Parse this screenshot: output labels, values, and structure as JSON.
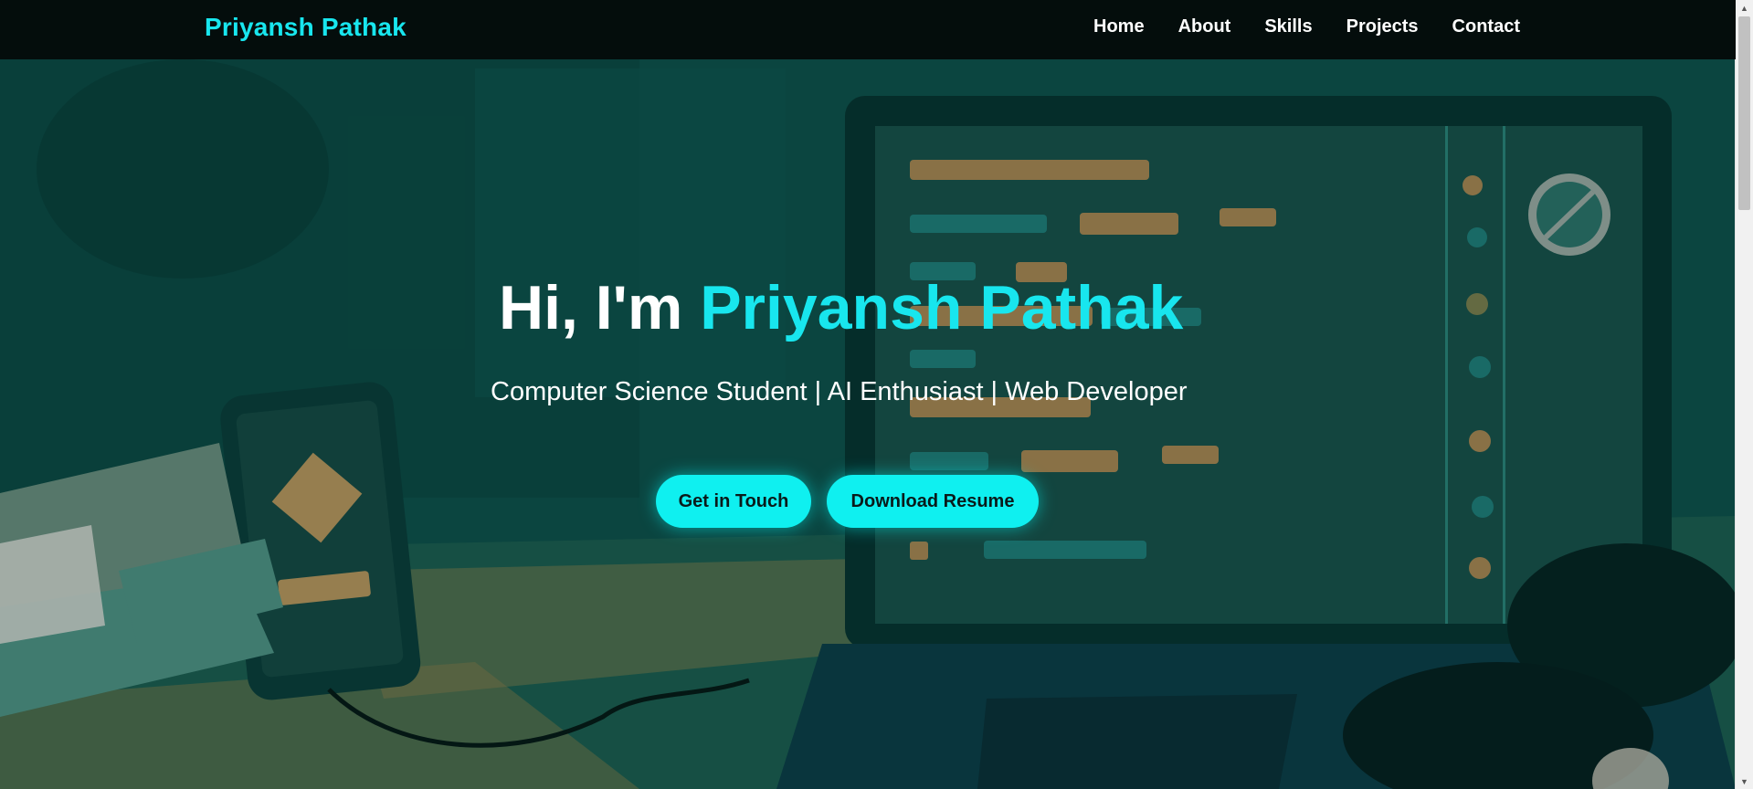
{
  "nav": {
    "brand": "Priyansh Pathak",
    "links": [
      "Home",
      "About",
      "Skills",
      "Projects",
      "Contact"
    ]
  },
  "hero": {
    "greeting": "Hi, I'm ",
    "name": "Priyansh Pathak",
    "tagline": "Computer Science Student | AI Enthusiast | Web Developer",
    "cta_primary": "Get in Touch",
    "cta_secondary": "Download Resume"
  },
  "colors": {
    "accent": "#18e6ee",
    "nav_bg": "#040d0c"
  }
}
